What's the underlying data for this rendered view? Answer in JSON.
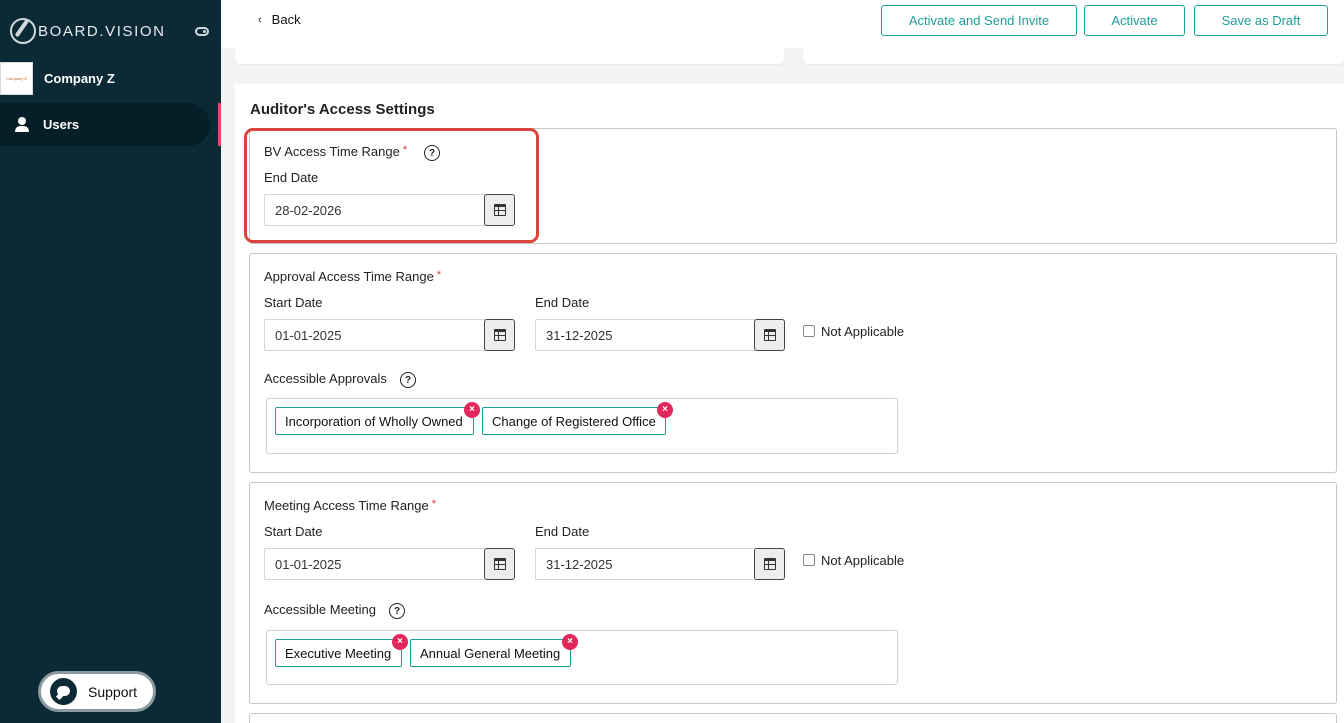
{
  "sidebar": {
    "brand": "BOARD.VISION",
    "company_logo_text": "Company Z",
    "company_name": "Company Z",
    "nav_users": "Users",
    "support": "Support"
  },
  "header": {
    "back": "Back",
    "activate_send_invite": "Activate and Send Invite",
    "activate": "Activate",
    "save_draft": "Save as Draft"
  },
  "main": {
    "section_title": "Auditor's Access Settings",
    "bv_access": {
      "label": "BV Access Time Range",
      "required": "*",
      "help": "?",
      "end_label": "End Date",
      "end_value": "28-02-2026"
    },
    "approval": {
      "label": "Approval Access Time Range",
      "required": "*",
      "start_label": "Start Date",
      "start_value": "01-01-2025",
      "end_label": "End Date",
      "end_value": "31-12-2025",
      "not_applicable": "Not Applicable",
      "accessible_label": "Accessible Approvals",
      "help": "?",
      "chips": [
        "Incorporation of Wholly Owned",
        "Change of Registered Office"
      ]
    },
    "meeting": {
      "label": "Meeting Access Time Range",
      "required": "*",
      "start_label": "Start Date",
      "start_value": "01-01-2025",
      "end_label": "End Date",
      "end_value": "31-12-2025",
      "not_applicable": "Not Applicable",
      "accessible_label": "Accessible Meeting",
      "help": "?",
      "chips": [
        "Executive Meeting",
        "Annual General Meeting"
      ]
    },
    "chip_remove": "×"
  },
  "colors": {
    "sidebar_bg": "#0c2a36",
    "accent": "#1f9e9a",
    "remove_red": "#e2285a",
    "highlight": "#d9453a"
  }
}
